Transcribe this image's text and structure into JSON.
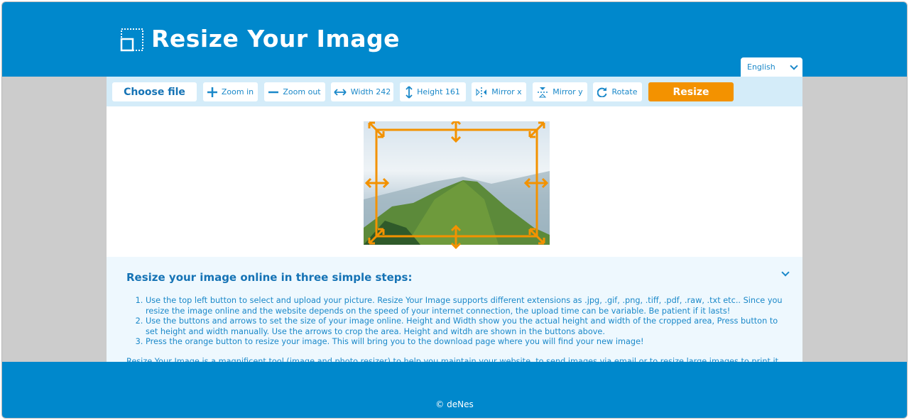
{
  "header": {
    "title": "Resize Your Image",
    "language": "English"
  },
  "toolbar": {
    "choose_file": "Choose file",
    "zoom_in": "Zoom in",
    "zoom_out": "Zoom out",
    "width": "Width 242",
    "height": "Height 161",
    "mirror_x": "Mirror x",
    "mirror_y": "Mirror y",
    "rotate": "Rotate",
    "resize": "Resize"
  },
  "info": {
    "heading": "Resize your image online in three simple steps:",
    "steps": [
      "Use the top left button to select and upload your picture. Resize Your Image supports different extensions as .jpg, .gif, .png, .tiff, .pdf, .raw, .txt etc.. Since you resize the image online and the website depends on the speed of your internet connection, the upload time can be variable. Be patient if it lasts!",
      "Use the buttons and arrows to set the size of your image online. Height and Width show you the actual height and width of the cropped area, Press button to set height and width manually. Use the arrows to crop the area. Height and witdh are shown in the buttons above.",
      "Press the orange button to resize your image. This will bring you to the download page where you will find your new image!"
    ],
    "description": "Resize Your Image is a magnificent tool (image and photo resizer) to help you maintain your website, to send images via email or to resize large images to print it. Not only does it let you determine its size (in pixels), it also brings down the size of your file."
  },
  "footer": {
    "copyright": "© deNes"
  },
  "colors": {
    "brand": "#0088cc",
    "accent": "#f39200",
    "toolbar": "#d4ecf9"
  }
}
